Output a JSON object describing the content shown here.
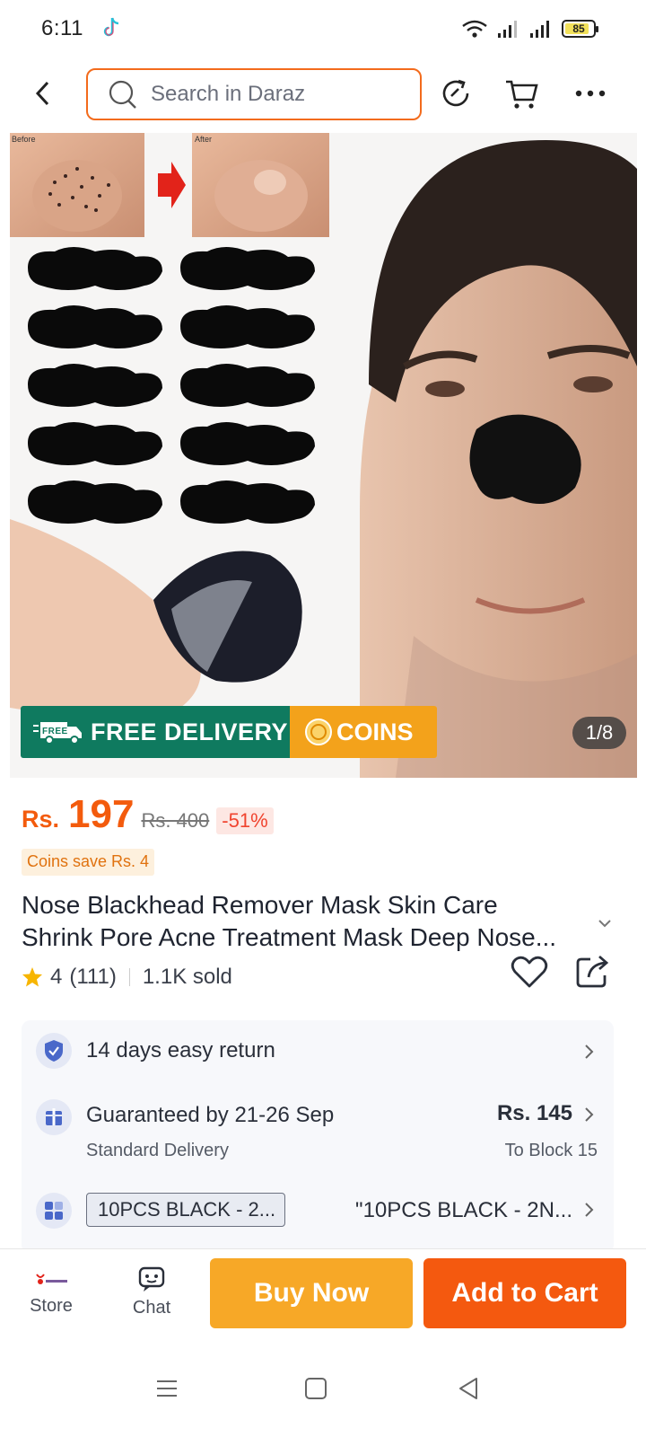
{
  "status_bar": {
    "time": "6:11",
    "battery": "85"
  },
  "header": {
    "search_placeholder": "Search in Daraz"
  },
  "product_image": {
    "counter": "1/8",
    "promo_free": "FREE DELIVERY",
    "promo_coins": "COINS",
    "before_label": "Before",
    "after_label": "After"
  },
  "price": {
    "currency": "Rs.",
    "value": "197",
    "original": "Rs. 400",
    "discount": "-51%",
    "coins_save": "Coins save Rs. 4"
  },
  "product": {
    "title_line1": "Nose Blackhead Remover Mask Skin Care",
    "title_line2": "Shrink Pore Acne Treatment Mask Deep Nose..."
  },
  "rating": {
    "score": "4",
    "count": "(111)",
    "sold": "1.1K sold",
    "star_color": "#f7b500"
  },
  "info": {
    "return_text": "14 days easy return",
    "delivery_text": "Guaranteed by 21-26 Sep",
    "delivery_type": "Standard Delivery",
    "delivery_price": "Rs. 145",
    "delivery_location": "To Block 15",
    "variant_chip": "10PCS BLACK - 2...",
    "variant_value": "\"10PCS BLACK - 2N..."
  },
  "bottom_bar": {
    "store_label": "Store",
    "chat_label": "Chat",
    "buy_now": "Buy Now",
    "add_to_cart": "Add to Cart"
  },
  "colors": {
    "accent": "#f36b1c",
    "buy_now": "#f7a827",
    "add_to_cart": "#f4590f",
    "free_delivery": "#0f7a5f",
    "coins": "#f3a21b"
  }
}
